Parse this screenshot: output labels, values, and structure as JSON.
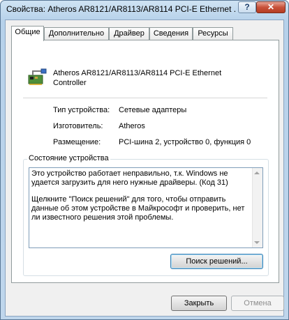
{
  "window": {
    "title": "Свойства: Atheros AR8121/AR8113/AR8114 PCI-E Ethernet ...",
    "help_label": "?",
    "close_label": "✕"
  },
  "tabs": [
    {
      "label": "Общие",
      "active": true
    },
    {
      "label": "Дополнительно",
      "active": false
    },
    {
      "label": "Драйвер",
      "active": false
    },
    {
      "label": "Сведения",
      "active": false
    },
    {
      "label": "Ресурсы",
      "active": false
    }
  ],
  "device": {
    "icon": "network-adapter-icon",
    "name": "Atheros AR8121/AR8113/AR8114 PCI-E Ethernet Controller"
  },
  "properties": [
    {
      "label": "Тип устройства:",
      "value": "Сетевые адаптеры"
    },
    {
      "label": "Изготовитель:",
      "value": "Atheros"
    },
    {
      "label": "Размещение:",
      "value": "PCI-шина 2, устройство 0, функция 0"
    }
  ],
  "status": {
    "group_title": "Состояние устройства",
    "paragraph1": "Это устройство работает неправильно, т.к. Windows не удается загрузить для него нужные драйверы. (Код 31)",
    "paragraph2": "Щелкните \"Поиск решений\" для того, чтобы отправить данные об этом устройстве в Майкрософт и проверить, нет ли известного решения этой проблемы.",
    "find_button": "Поиск решений..."
  },
  "buttons": {
    "ok": "Закрыть",
    "cancel": "Отмена"
  }
}
